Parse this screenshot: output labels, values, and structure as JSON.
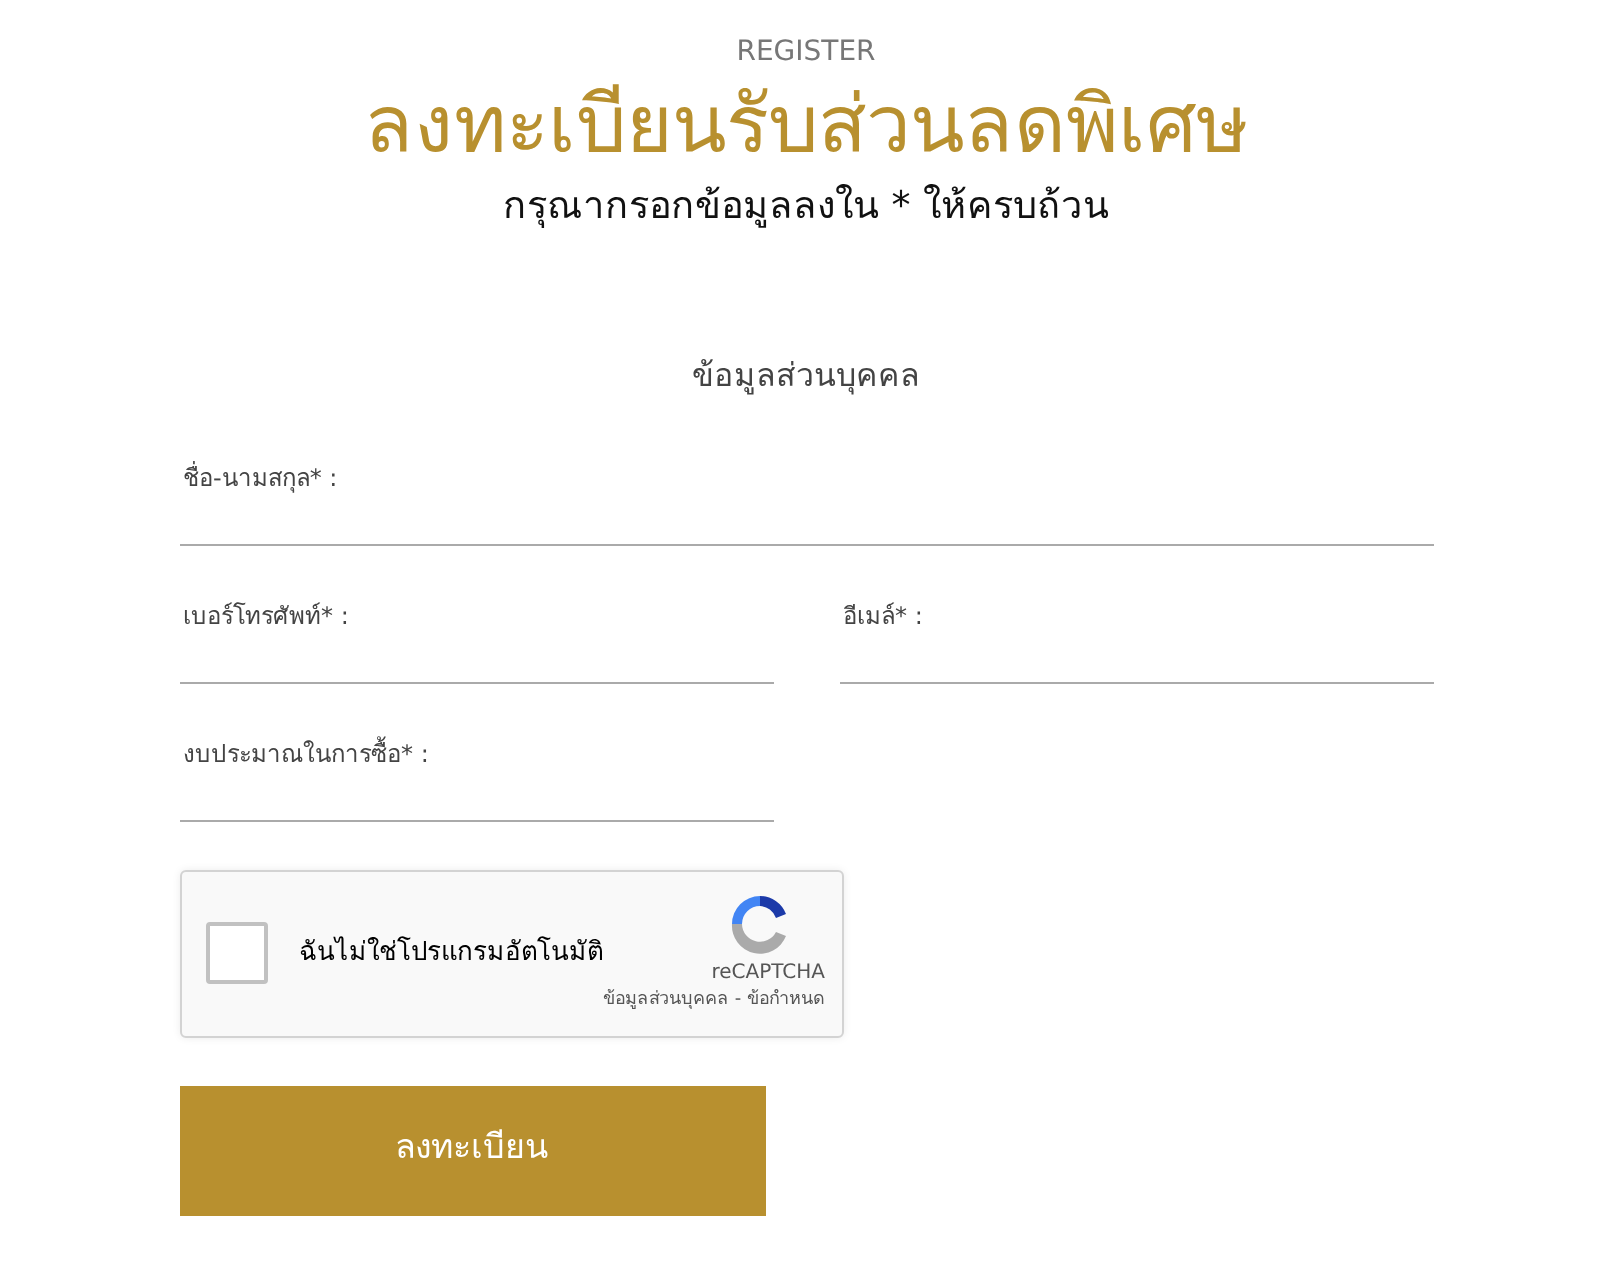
{
  "header": {
    "eyebrow": "REGISTER",
    "title": "ลงทะเบียนรับส่วนลดพิเศษ",
    "subtitle": "กรุณากรอกข้อมูลลงใน * ให้ครบถ้วน"
  },
  "section_title": "ข้อมูลส่วนบุคคล",
  "fields": [
    {
      "placeholder": "ชื่อ-นามสกุล* :",
      "kind": "wide"
    },
    {
      "placeholder": "เบอร์โทรศัพท์* :",
      "kind": "half"
    },
    {
      "placeholder": "อีเมล์* :",
      "kind": "half"
    },
    {
      "placeholder": "งบประมาณในการซื้อ* :",
      "kind": "half"
    }
  ],
  "captcha": {
    "label": "ฉันไม่ใช่โปรแกรมอัตโนมัติ",
    "checked": false,
    "brand": "reCAPTCHA",
    "privacy": "ข้อมูลส่วนบุคคล",
    "separator": "-",
    "terms": "ข้อกำหนด"
  },
  "submit": "ลงทะเบียน"
}
